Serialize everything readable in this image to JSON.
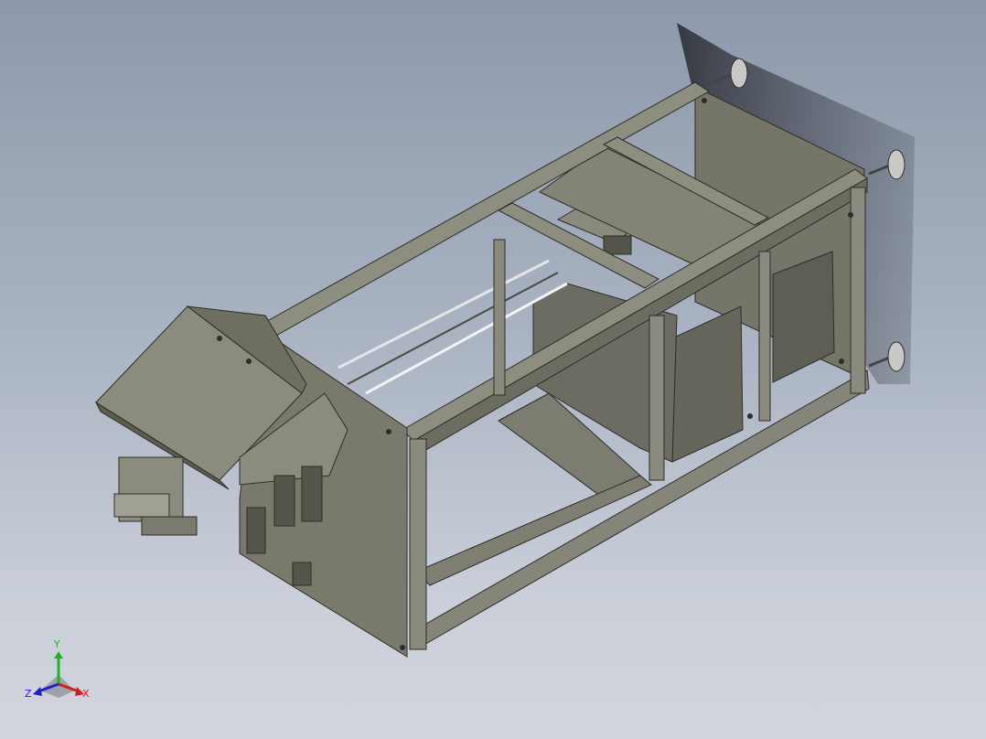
{
  "viewport": {
    "background_top": "#8d99ab",
    "background_bottom": "#d2d5dc",
    "model_color": "#7a7a6c",
    "model_dark": "#5e5e52",
    "model_light": "#9c9c8c"
  },
  "triad": {
    "x_label": "X",
    "y_label": "Y",
    "z_label": "Z",
    "x_color": "#d21e1e",
    "y_color": "#1fb51f",
    "z_color": "#1e1ed2"
  }
}
